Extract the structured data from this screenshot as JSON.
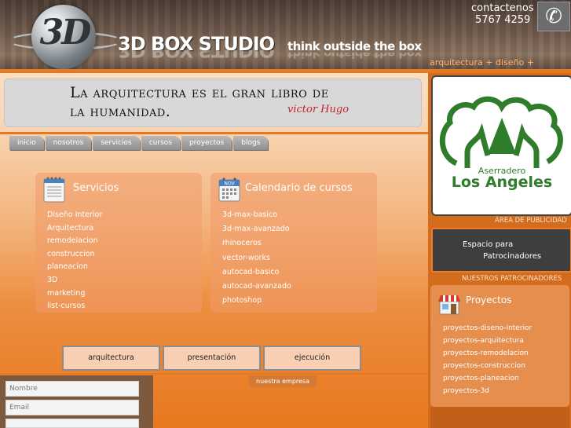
{
  "header": {
    "logo_text": "3D",
    "brand": "3D BOX STUDIO",
    "tagline": "think outside the box",
    "contact_label": "contactenos",
    "contact_phone": "5767 4259",
    "services_line": "arquitectura + diseño + construccion"
  },
  "quote": {
    "line1": "La arquitectura es el gran libro de",
    "line2": "la humanidad.",
    "author": "victor Hugo"
  },
  "nav": {
    "tabs": [
      "inicio",
      "nosotros",
      "servicios",
      "cursos",
      "proyectos",
      "blogs"
    ]
  },
  "services": {
    "title": "Servicios",
    "items": [
      "Diseño Interior",
      "Arquitectura",
      "remodelacion",
      "construccion",
      "planeacion",
      "3D",
      "marketing",
      "list-cursos"
    ]
  },
  "calendar": {
    "title": "Calendario de cursos",
    "icon_label": "NOV",
    "items": [
      "3d-max-basico",
      "3d-max-avanzado",
      "rhinoceros",
      "vector-works",
      "autocad-basico",
      "autocad-avanzado",
      "photoshop"
    ]
  },
  "bottom_buttons": [
    "arquitectura",
    "presentación",
    "ejecución"
  ],
  "footer_tab": "nuestra empresa",
  "form": {
    "name_placeholder": "Nombre",
    "email_placeholder": "Email"
  },
  "sidebar": {
    "sponsor_logo_small": "Aserradero",
    "sponsor_logo_big": "Los Angeles",
    "ad_area_label": "ÁREA DE PUBLICIDAD",
    "ad_space_line1": "Espacio para",
    "ad_space_line2": "Patrocinadores",
    "sponsors_label": "NUESTROS PATROCINADORES",
    "projects_title": "Proyectos",
    "projects": [
      "proyectos-diseno-interior",
      "proyectos-arquitectura",
      "proyectos-remodelacion",
      "proyectos-construccion",
      "proyectos-planeacion",
      "proyectos-3d"
    ]
  },
  "colors": {
    "accent": "#e8781f",
    "sponsor_green": "#2f7d2b",
    "quote_author": "#c6242a"
  }
}
